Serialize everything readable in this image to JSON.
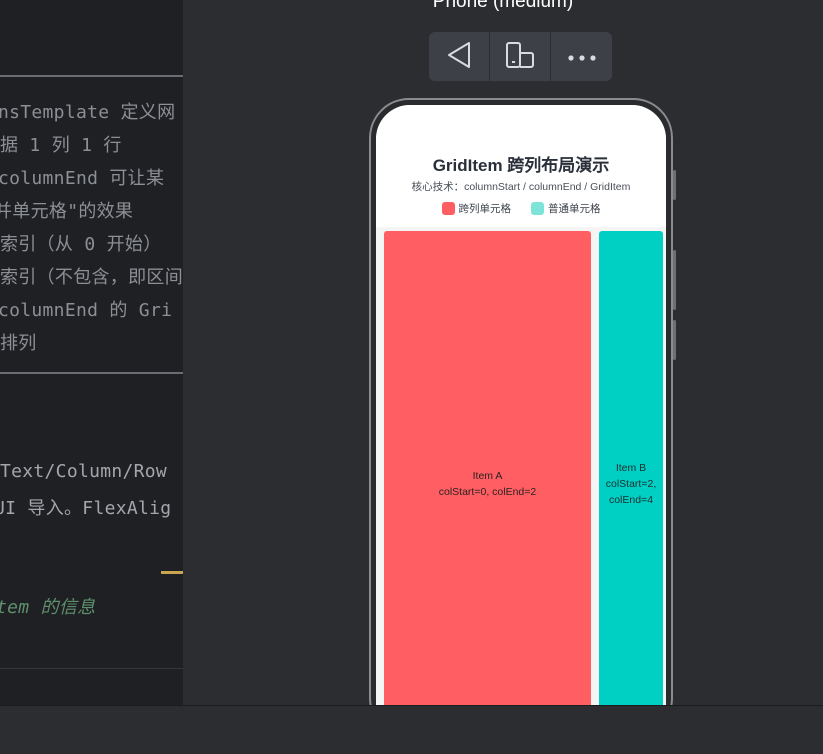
{
  "editor": {
    "lines": [
      "nsTemplate 定义网",
      "据 1 列 1 行",
      "columnEnd 可让某",
      "并单元格\"的效果",
      "索引（从 0 开始）",
      "索引（不包含，即区间",
      "columnEnd 的 Gri",
      "排列",
      "Text/Column/Row",
      "UI 导入。FlexAlig",
      "tem 的信息"
    ]
  },
  "preview": {
    "device_label": "Phone (medium)",
    "toolbar": {
      "icons": [
        "rotate-triangle-icon",
        "device-switch-icon",
        "more-options-icon"
      ]
    }
  },
  "app": {
    "title": "GridItem 跨列布局演示",
    "subtitle": "核心技术：columnStart / columnEnd / GridItem",
    "legend": [
      {
        "label": "跨列单元格",
        "color": "#ff5f62"
      },
      {
        "label": "普通单元格",
        "color": "#7ee3d9"
      }
    ],
    "items": [
      {
        "name": "Item A",
        "detail": "colStart=0, colEnd=2",
        "color": "#ff5f62"
      },
      {
        "name": "Item B",
        "detail_1": "colStart=2,",
        "detail_2": "colEnd=4",
        "color": "#00cfc3"
      }
    ]
  }
}
